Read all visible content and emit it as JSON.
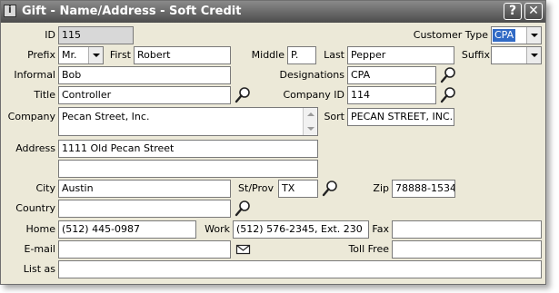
{
  "window": {
    "title": "Gift - Name/Address - Soft Credit",
    "help_label": "?",
    "close_label": "✕"
  },
  "labels": {
    "id": "ID",
    "customer_type": "Customer Type",
    "prefix": "Prefix",
    "first": "First",
    "middle": "Middle",
    "last": "Last",
    "suffix": "Suffix",
    "informal": "Informal",
    "designations": "Designations",
    "title": "Title",
    "company_id": "Company ID",
    "company": "Company",
    "sort": "Sort",
    "address": "Address",
    "city": "City",
    "st_prov": "St/Prov",
    "zip": "Zip",
    "country": "Country",
    "home": "Home",
    "work": "Work",
    "fax": "Fax",
    "email": "E-mail",
    "toll_free": "Toll Free",
    "list_as": "List as"
  },
  "values": {
    "id": "115",
    "customer_type": "CPA",
    "prefix": "Mr.",
    "first": "Robert",
    "middle": "P.",
    "last": "Pepper",
    "suffix": "",
    "informal": "Bob",
    "designations": "CPA",
    "title": "Controller",
    "company_id": "114",
    "company": "Pecan Street, Inc.",
    "sort": "PECAN STREET, INC.",
    "address1": "1111 Old Pecan Street",
    "address2": "",
    "city": "Austin",
    "st_prov": "TX",
    "zip": "78888-1534",
    "country": "",
    "home": "(512) 445-0987",
    "work": "(512) 576-2345, Ext. 230",
    "fax": "",
    "email": "",
    "toll_free": "",
    "list_as": ""
  },
  "icons": {
    "lookup": "magnifier-icon",
    "email": "envelope-icon",
    "app": "app-icon"
  }
}
